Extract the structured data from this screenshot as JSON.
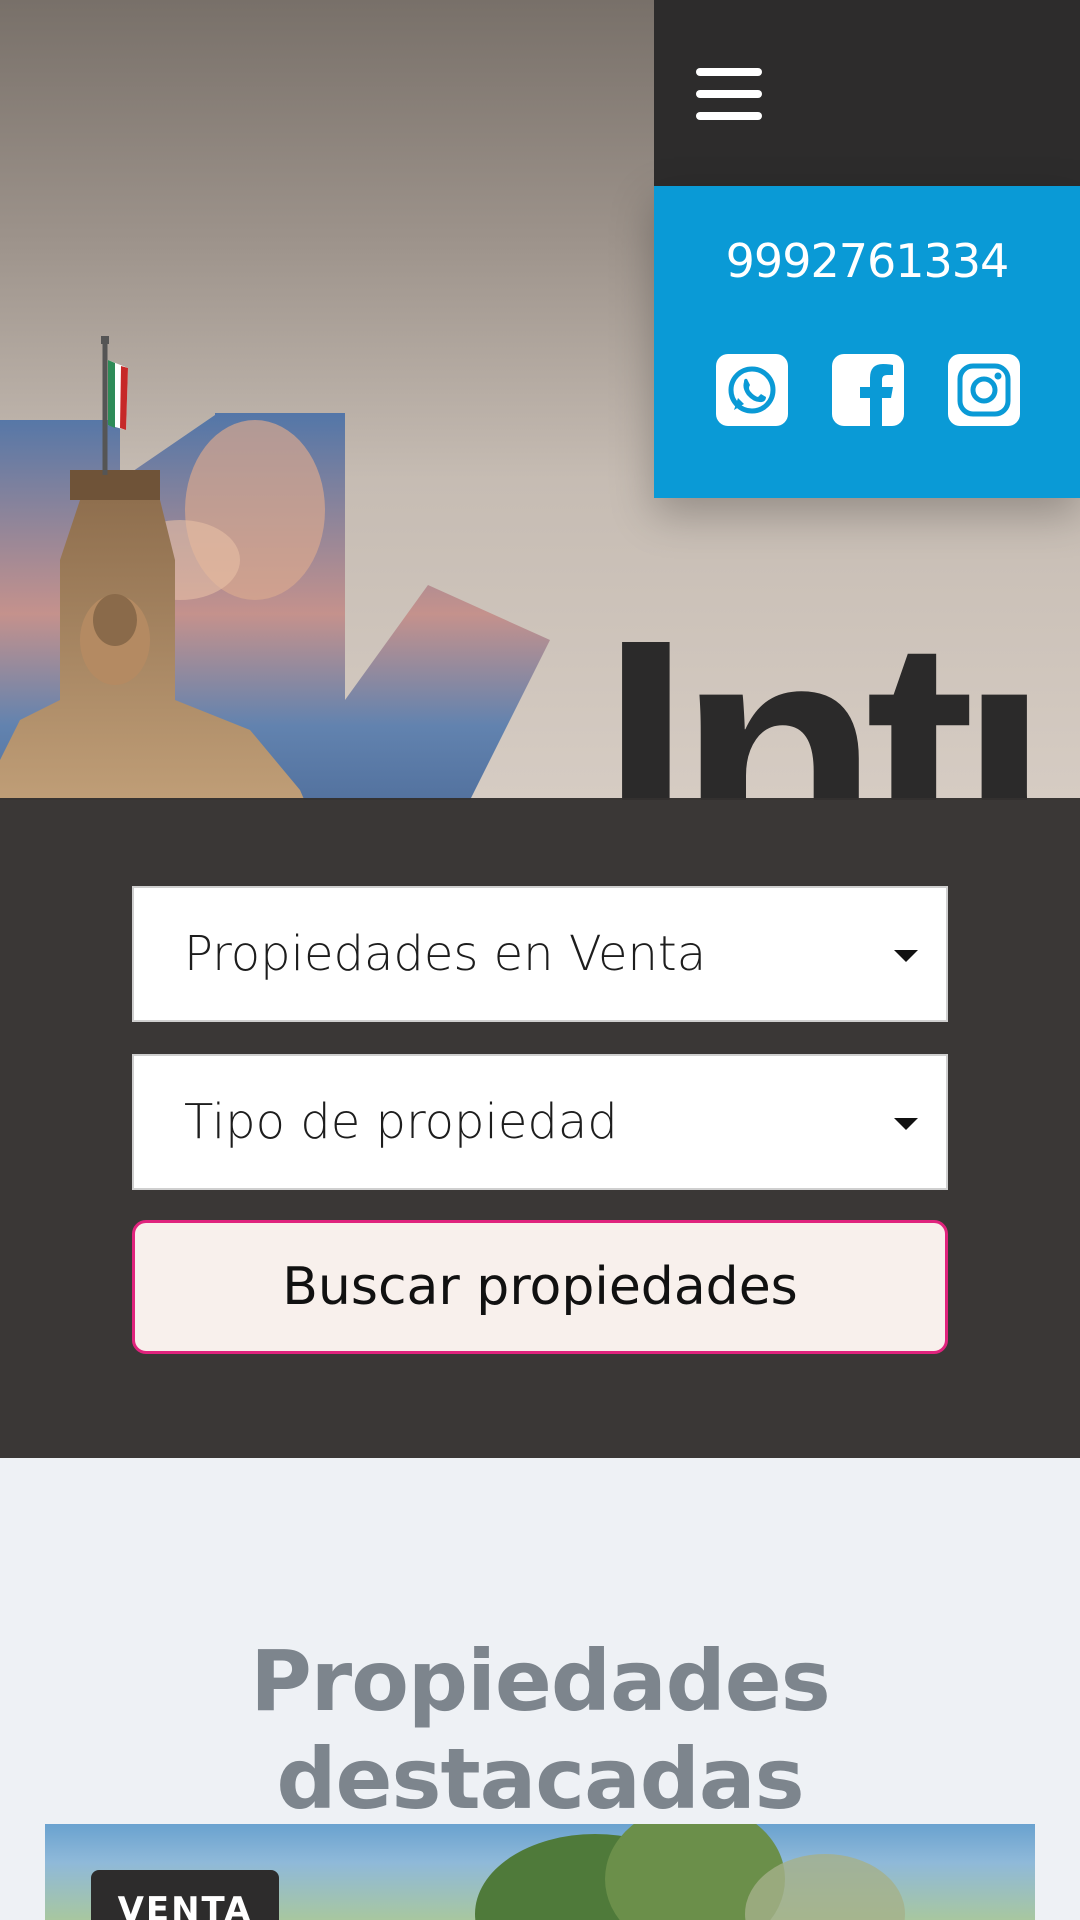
{
  "hero": {
    "brand_word": "Intu"
  },
  "header": {
    "menu_icon": "hamburger-menu-icon",
    "phone": "9992761334",
    "social": [
      {
        "icon": "whatsapp-icon"
      },
      {
        "icon": "facebook-icon"
      },
      {
        "icon": "instagram-icon"
      }
    ]
  },
  "search": {
    "operation_select": "Propiedades en Venta",
    "type_select": "Tipo de propiedad",
    "button_label": "Buscar propiedades"
  },
  "featured": {
    "title": "Propiedades destacadas",
    "cards": [
      {
        "badge": "VENTA"
      }
    ]
  },
  "colors": {
    "header_dark": "#2d2c2c",
    "contact_blue": "#0a9ad6",
    "search_panel": "#343130",
    "button_border": "#e0237d",
    "button_bg": "#f8f0ec",
    "featured_title": "#7d858d",
    "page_bg": "#eef1f5"
  }
}
